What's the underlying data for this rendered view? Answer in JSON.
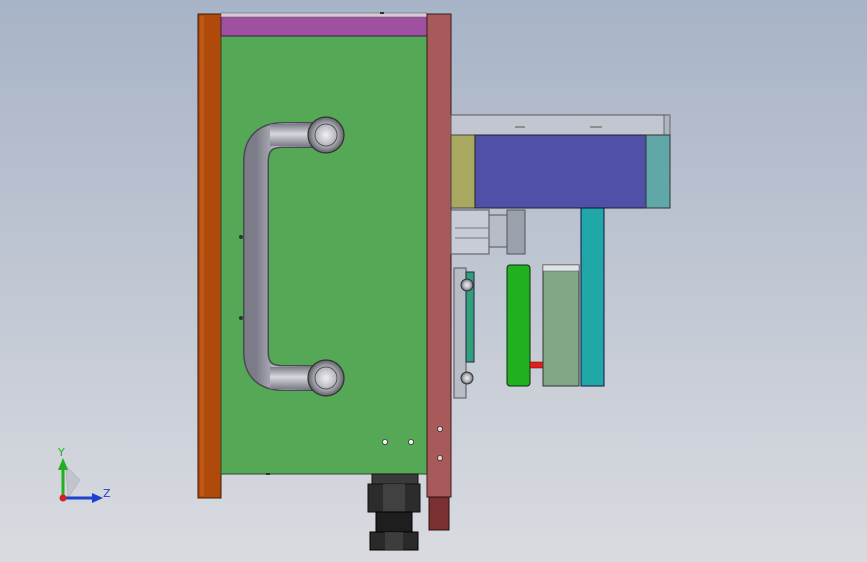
{
  "triad": {
    "y_label": "Y",
    "z_label": "Z"
  },
  "colors": {
    "background_top": "#a7b3c7",
    "background_bottom": "#d9dbe0",
    "left_plate": "#b04a0a",
    "main_body": "#55a855",
    "top_strip": "#a050a0",
    "right_plate": "#a85a5a",
    "blue_block": "#5050a8",
    "olive_block": "#a8a860",
    "teal_block": "#60a8a8",
    "teal_post": "#20a8a8",
    "green_bar": "#20b020",
    "gray_green_block": "#80a888",
    "handle": "#a8a8b0",
    "axis_y": "#20b020",
    "axis_z": "#2040d0",
    "origin": "#d02020"
  },
  "icons": [
    "handle-icon",
    "bolt-icon",
    "nut-icon",
    "view-triad-icon"
  ]
}
